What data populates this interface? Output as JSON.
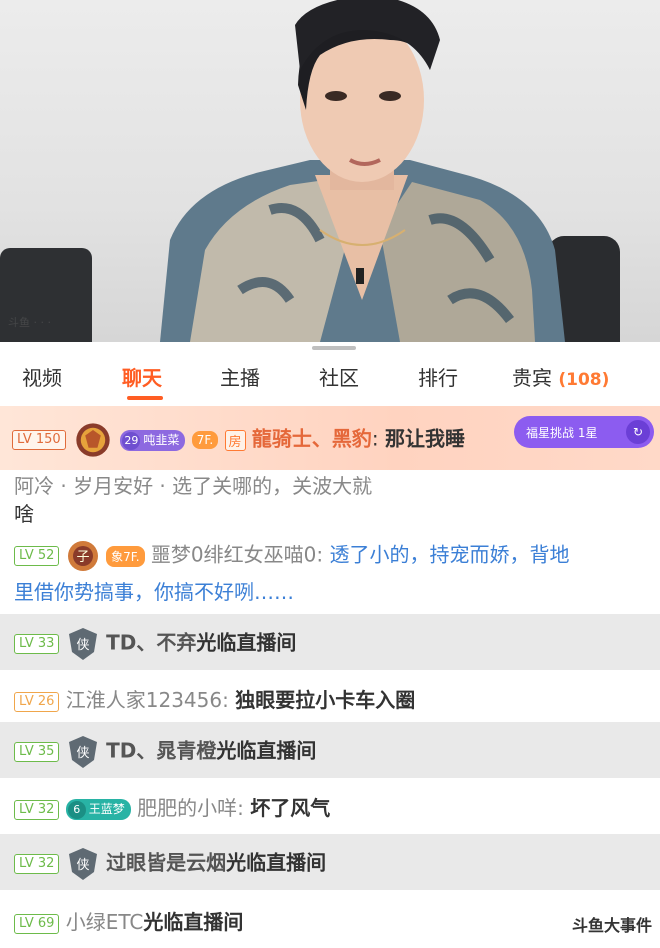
{
  "tabs": [
    {
      "label": "视频"
    },
    {
      "label": "聊天"
    },
    {
      "label": "主播"
    },
    {
      "label": "社区"
    },
    {
      "label": "排行"
    },
    {
      "label": "贵宾",
      "count": "(108)"
    }
  ],
  "active_tab": "聊天",
  "colors": {
    "accent": "#ff5d23",
    "level_green": "#6dbb4a",
    "link_blue": "#3b7fd6"
  },
  "pinned": {
    "level": "LV 150",
    "fan_level": "29",
    "fan_name": "吨韭菜",
    "badge2": "7F.",
    "room_badge": "房",
    "user": "龍骑士、黑豹",
    "text": "那让我睡"
  },
  "challenge": {
    "label": "福星挑战 1星"
  },
  "chat": {
    "partial": {
      "text_tail": "阿冷 · 岁月安好 · 选了关哪的，关波大就",
      "continued": "啥"
    },
    "msg1": {
      "level": "LV 52",
      "badge": "7F.",
      "badge_color": "象",
      "user": "噩梦0绯红女巫喵0:",
      "line1": "透了小的，持宠而娇，背地",
      "line2": "里借你势搞事，你搞不好咧……"
    },
    "msg2": {
      "level": "LV 33",
      "user": "TD、不弃",
      "text": "光临直播间"
    },
    "msg3": {
      "level": "LV 26",
      "user": "江淮人家123456:",
      "text": "独眼要拉小卡车入圈"
    },
    "msg4": {
      "level": "LV 35",
      "user": "TD、晁青橙",
      "text": "光临直播间"
    },
    "msg5": {
      "level": "LV 32",
      "fan_level": "6",
      "fan_name": "王蓝梦",
      "user": "肥肥的小咩:",
      "text": "坏了风气"
    },
    "msg6": {
      "level": "LV 32",
      "user": "过眼皆是云烟",
      "text": "光临直播间"
    },
    "msg7": {
      "level": "LV 69",
      "user": "小绿ETC",
      "text": "光临直播间"
    }
  },
  "watermark": "斗鱼大事件"
}
